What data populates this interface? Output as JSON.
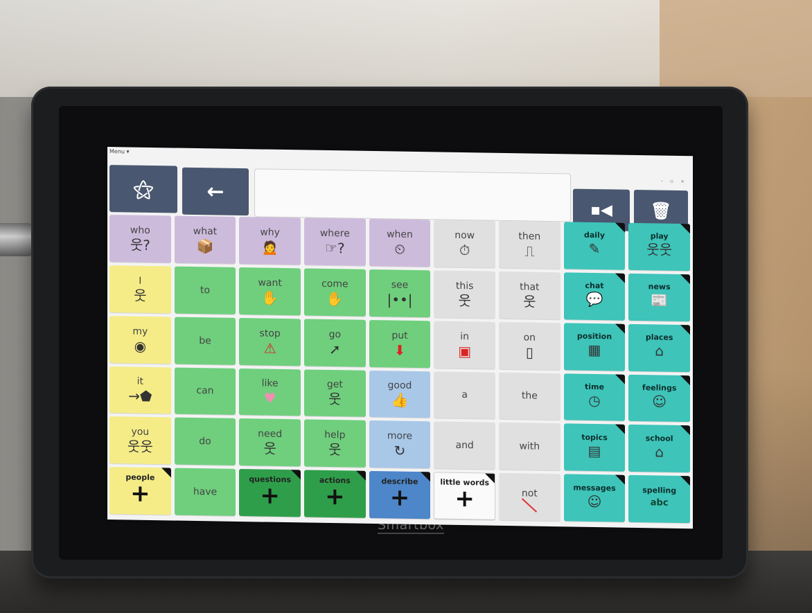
{
  "window": {
    "menu_label": "Menu ▾"
  },
  "toolbar": {
    "magic_icon": "magic-wand-icon",
    "back_icon": "back-arrow-icon",
    "delete_word_icon": "delete-word-icon",
    "clear_icon": "trash-icon",
    "message_text": ""
  },
  "device": {
    "brand": "Smartbox"
  },
  "colors": {
    "purple": "#cdbbdc",
    "grey": "#e0e0e0",
    "teal": "#3ec4b9",
    "yellow": "#f5ec88",
    "green": "#6fcf7d",
    "dark_green": "#2f9e4a",
    "blue": "#a9c8e8",
    "dark_blue": "#4d86c9",
    "toolbar": "#4a5770"
  },
  "grid": [
    [
      {
        "label": "who",
        "symbol": "웃?"
      },
      {
        "label": "what",
        "symbol": "📦"
      },
      {
        "label": "why",
        "symbol": "🙍"
      },
      {
        "label": "where",
        "symbol": "☞?"
      },
      {
        "label": "when",
        "symbol": "⏲"
      },
      {
        "label": "now",
        "symbol": "⏱"
      },
      {
        "label": "then",
        "symbol": "⎍"
      },
      {
        "label": "daily",
        "symbol": "✎"
      },
      {
        "label": "play",
        "symbol": "웃웃"
      }
    ],
    [
      {
        "label": "I",
        "symbol": "웃"
      },
      {
        "label": "to",
        "symbol": ""
      },
      {
        "label": "want",
        "symbol": "✋"
      },
      {
        "label": "come",
        "symbol": "✋"
      },
      {
        "label": "see",
        "symbol": "|••|"
      },
      {
        "label": "this",
        "symbol": "웃"
      },
      {
        "label": "that",
        "symbol": "웃"
      },
      {
        "label": "chat",
        "symbol": "💬"
      },
      {
        "label": "news",
        "symbol": "📰"
      }
    ],
    [
      {
        "label": "my",
        "symbol": "◉"
      },
      {
        "label": "be",
        "symbol": ""
      },
      {
        "label": "stop",
        "symbol": "⚠"
      },
      {
        "label": "go",
        "symbol": "➚"
      },
      {
        "label": "put",
        "symbol": "⬇"
      },
      {
        "label": "in",
        "symbol": "▣"
      },
      {
        "label": "on",
        "symbol": "▯"
      },
      {
        "label": "position",
        "symbol": "▦"
      },
      {
        "label": "places",
        "symbol": "⌂"
      }
    ],
    [
      {
        "label": "it",
        "symbol": "→⬟"
      },
      {
        "label": "can",
        "symbol": ""
      },
      {
        "label": "like",
        "symbol": "♥"
      },
      {
        "label": "get",
        "symbol": "웃"
      },
      {
        "label": "good",
        "symbol": "👍"
      },
      {
        "label": "a",
        "symbol": ""
      },
      {
        "label": "the",
        "symbol": ""
      },
      {
        "label": "time",
        "symbol": "◷"
      },
      {
        "label": "feelings",
        "symbol": "☺"
      }
    ],
    [
      {
        "label": "you",
        "symbol": "웃웃"
      },
      {
        "label": "do",
        "symbol": ""
      },
      {
        "label": "need",
        "symbol": "웃"
      },
      {
        "label": "help",
        "symbol": "웃"
      },
      {
        "label": "more",
        "symbol": "↻"
      },
      {
        "label": "and",
        "symbol": ""
      },
      {
        "label": "with",
        "symbol": ""
      },
      {
        "label": "topics",
        "symbol": "▤"
      },
      {
        "label": "school",
        "symbol": "⌂"
      }
    ],
    [
      {
        "label": "people",
        "symbol": "+"
      },
      {
        "label": "have",
        "symbol": ""
      },
      {
        "label": "questions",
        "symbol": "+"
      },
      {
        "label": "actions",
        "symbol": "+"
      },
      {
        "label": "describe",
        "symbol": "+"
      },
      {
        "label": "little words",
        "symbol": "+"
      },
      {
        "label": "not",
        "symbol": ""
      },
      {
        "label": "messages",
        "symbol": "☺"
      },
      {
        "label": "spelling",
        "symbol": "abc"
      }
    ]
  ]
}
